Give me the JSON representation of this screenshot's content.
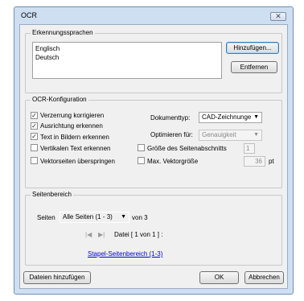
{
  "dialog": {
    "title": "OCR",
    "close_glyph": "✕",
    "languages": {
      "group_label": "Erkennungssprachen",
      "items": [
        "Englisch",
        "Deutsch"
      ],
      "add_button": "Hinzufügen...",
      "remove_button": "Entfernen"
    },
    "config": {
      "group_label": "OCR-Konfiguration",
      "checkboxes_left": [
        {
          "label": "Verzerrung korrigieren",
          "checked": true
        },
        {
          "label": "Ausrichtung erkennen",
          "checked": true
        },
        {
          "label": "Text in Bildern erkennen",
          "checked": true
        },
        {
          "label": "Vertikalen Text erkennen",
          "checked": false
        },
        {
          "label": "Vektorseiten überspringen",
          "checked": false
        }
      ],
      "doctype_label": "Dokumenttyp:",
      "doctype_value": "CAD-Zeichnunge",
      "optimize_label": "Optimieren für:",
      "optimize_value": "Genauigkeit",
      "pagesection_label": "Größe des Seitenabschnitts",
      "pagesection_value": "1",
      "maxvector_label": "Max. Vektorgröße",
      "maxvector_value": "36",
      "maxvector_unit": "pt"
    },
    "pagerange": {
      "group_label": "Seitenbereich",
      "pages_label": "Seiten",
      "pages_value": "Alle Seiten (1 - 3)",
      "of_label": "von 3",
      "file_label": "Datei [ 1 von 1 ] :",
      "batch_link": "Stapel-Seitenbereich (1-3)"
    },
    "footer": {
      "add_files": "Dateien hinzufügen",
      "ok": "OK",
      "cancel": "Abbrechen"
    }
  },
  "icons": {
    "close": "close-icon",
    "dropdown": "chevron-down-icon",
    "first_page": "first-page-icon",
    "next_page": "next-page-icon",
    "check": "check-icon"
  }
}
